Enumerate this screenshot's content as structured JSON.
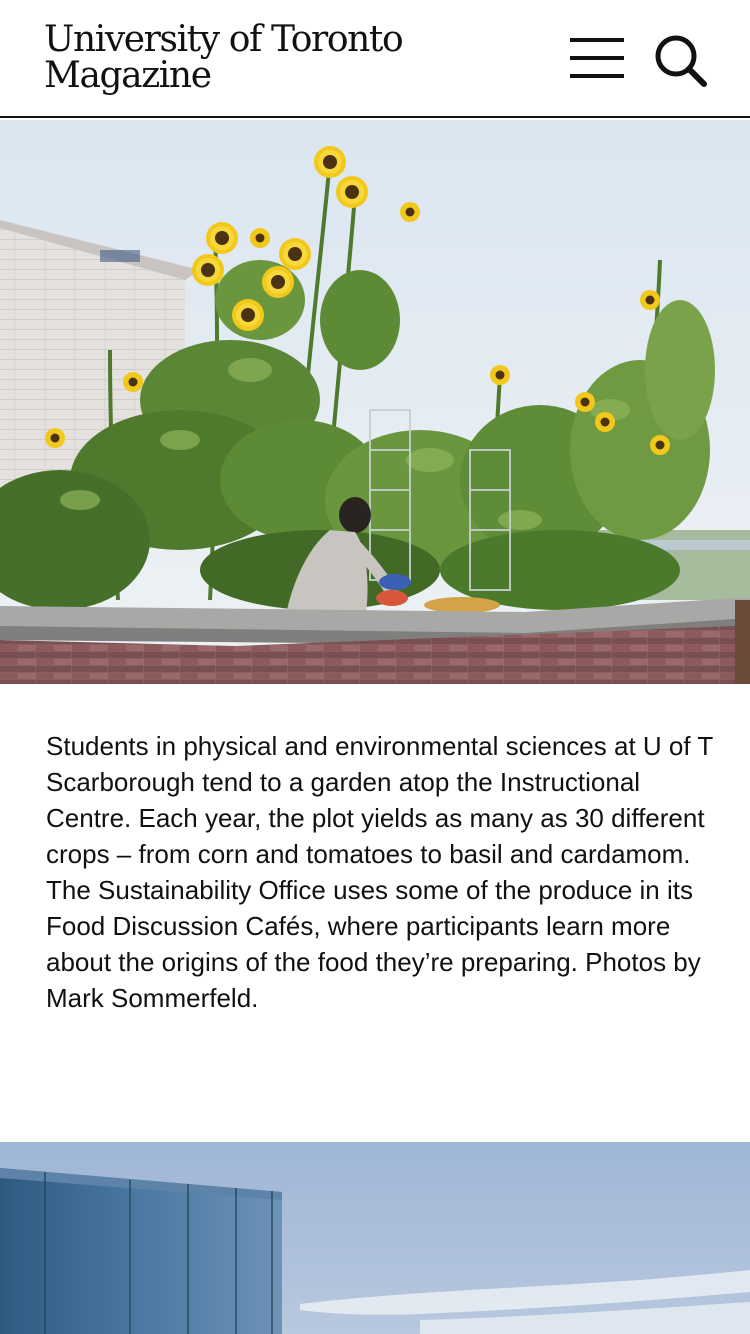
{
  "header": {
    "logo_line1": "University of Toronto",
    "logo_line2": "Magazine",
    "menu_icon": "hamburger-menu-icon",
    "search_icon": "search-icon"
  },
  "article": {
    "photo_garden_icon": "rooftop-garden-photo",
    "caption": "Students in physical and environmental sciences at U of T Scarborough tend to a garden atop the Instructional Centre. Each year, the plot yields as many as 30 different crops – from corn and tomatoes to basil and cardamom. The Sustainability Office uses some of the produce in its Food Discussion Cafés, where participants learn more about the origins of the food they’re preparing. Photos by Mark Sommerfeld.",
    "photo_building_icon": "rooftop-building-photo"
  },
  "colors": {
    "text": "#111111",
    "background": "#ffffff",
    "sky": "#dfe8f2",
    "brick": "#8a5a5c",
    "leaf": "#4f7a2e",
    "sunflower": "#f2c81a",
    "cladding": "#3f6f95"
  }
}
